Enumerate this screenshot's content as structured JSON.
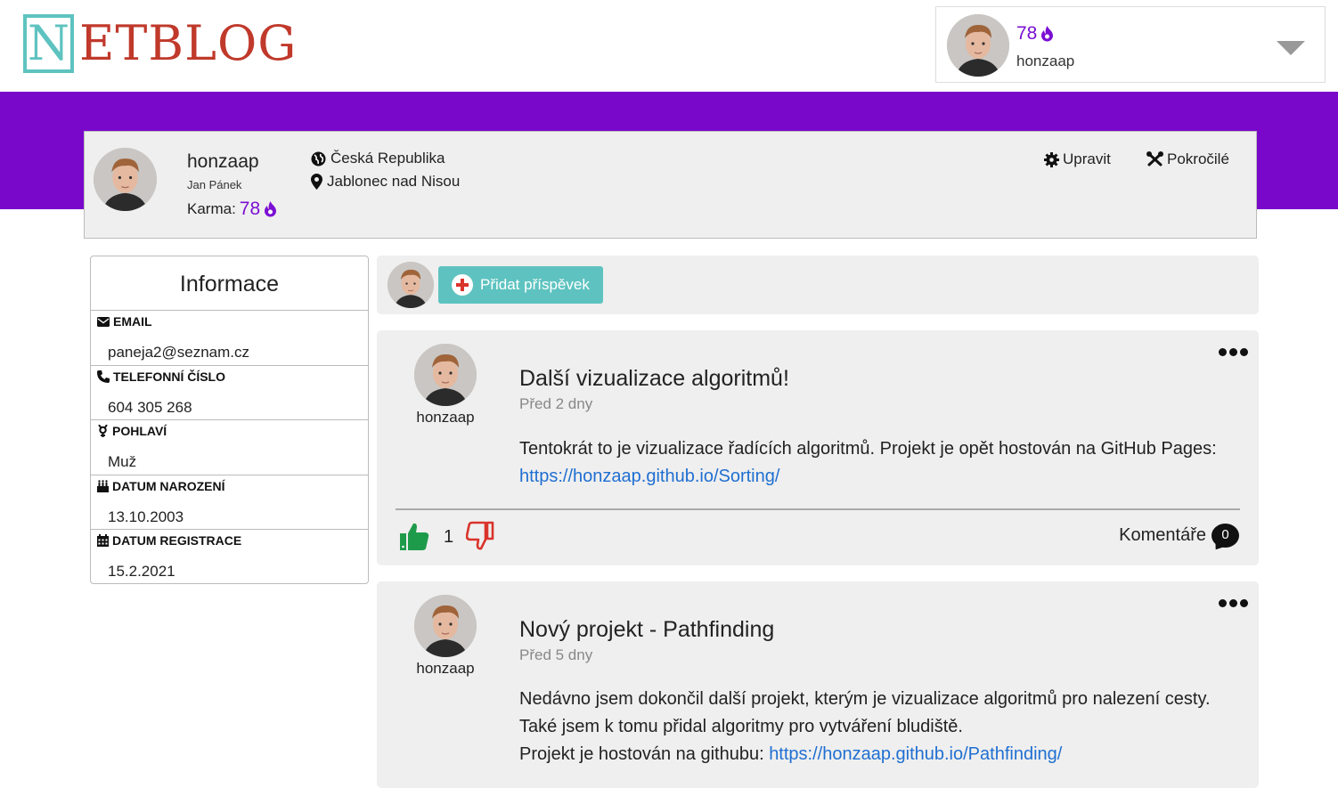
{
  "header": {
    "logo_first": "N",
    "logo_rest": "ETBLOG",
    "user": {
      "karma": "78",
      "name": "honzaap"
    }
  },
  "profile": {
    "username": "honzaap",
    "full_name": "Jan Pánek",
    "karma_label": "Karma:",
    "karma": "78",
    "country": "Česká Republika",
    "city": "Jablonec nad Nisou",
    "edit_label": "Upravit",
    "advanced_label": "Pokročilé"
  },
  "info": {
    "title": "Informace",
    "rows": [
      {
        "label": "EMAIL",
        "value": "paneja2@seznam.cz",
        "icon": "envelope-icon"
      },
      {
        "label": "TELEFONNÍ ČÍSLO",
        "value": "604 305 268",
        "icon": "phone-icon"
      },
      {
        "label": "POHLAVÍ",
        "value": "Muž",
        "icon": "gender-icon"
      },
      {
        "label": "DATUM NAROZENÍ",
        "value": "13.10.2003",
        "icon": "birthday-cake-icon"
      },
      {
        "label": "DATUM REGISTRACE",
        "value": "15.2.2021",
        "icon": "calendar-icon"
      }
    ]
  },
  "composer": {
    "add_label": "Přidat příspěvek"
  },
  "posts": [
    {
      "author": "honzaap",
      "title": "Další vizualizace algoritmů!",
      "time": "Před 2 dny",
      "body_1": "Tentokrát to je vizualizace řadících algoritmů. Projekt je opět hostován na GitHub Pages:",
      "link_1": "https://honzaap.github.io/Sorting/",
      "likes": "1",
      "comments_label": "Komentáře",
      "comments_count": "0"
    },
    {
      "author": "honzaap",
      "title": "Nový projekt - Pathfinding",
      "time": "Před 5 dny",
      "body_1": "Nedávno jsem dokončil další projekt, kterým je vizualizace algoritmů pro nalezení cesty.",
      "body_2": "Také jsem k tomu přidal algoritmy pro vytváření bludiště.",
      "body_3": "Projekt je hostován na githubu: ",
      "link_1": "https://honzaap.github.io/Pathfinding/"
    }
  ],
  "colors": {
    "brand_purple": "#7a08cb",
    "teal": "#5ec3c0",
    "logo_red": "#c0392b",
    "like_green": "#1e9b4a",
    "dislike_red": "#d9342b",
    "link_blue": "#1f6fd1"
  }
}
